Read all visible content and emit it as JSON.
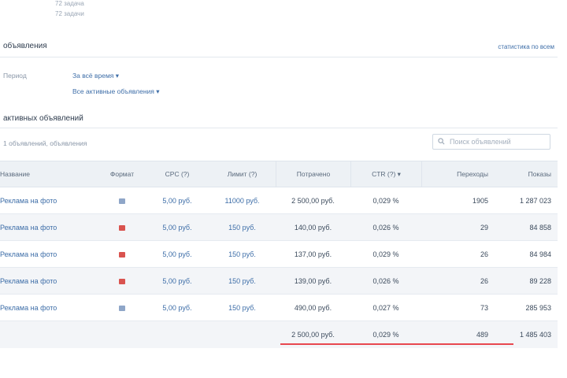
{
  "top_rows": [
    {
      "value": "72 задача"
    },
    {
      "value": "72 задачи"
    }
  ],
  "section1": {
    "title": "объявления",
    "right_link": "статистика по всем"
  },
  "filters": {
    "label": "Период",
    "time_select": "За всё время ▾",
    "ads_select": "Все активные объявления ▾"
  },
  "section2": {
    "title": "активных объявлений",
    "subtitle": "1 объявлений, объявления"
  },
  "search": {
    "placeholder": "Поиск объявлений"
  },
  "table": {
    "headers": {
      "name": "Название",
      "format": "Формат",
      "cpc": "CPC (?)",
      "limit": "Лимит (?)",
      "spent": "Потрачено",
      "ctr": "CTR (?) ▾",
      "clicks": "Переходы",
      "impressions": "Показы"
    },
    "rows": [
      {
        "name": "Реклама на фото",
        "format_color": "#8fa6c8",
        "cpc": "5,00 руб.",
        "limit": "11000 руб.",
        "spent": "2 500,00 руб.",
        "ctr": "0,029 %",
        "clicks": "1905",
        "impressions": "1 287 023"
      },
      {
        "name": "Реклама на фото",
        "format_color": "#d9534f",
        "cpc": "5,00 руб.",
        "limit": "150 руб.",
        "spent": "140,00 руб.",
        "ctr": "0,026 %",
        "clicks": "29",
        "impressions": "84 858"
      },
      {
        "name": "Реклама на фото",
        "format_color": "#d9534f",
        "cpc": "5,00 руб.",
        "limit": "150 руб.",
        "spent": "137,00 руб.",
        "ctr": "0,029 %",
        "clicks": "26",
        "impressions": "84 984"
      },
      {
        "name": "Реклама на фото",
        "format_color": "#d9534f",
        "cpc": "5,00 руб.",
        "limit": "150 руб.",
        "spent": "139,00 руб.",
        "ctr": "0,026 %",
        "clicks": "26",
        "impressions": "89 228"
      },
      {
        "name": "Реклама на фото",
        "format_color": "#8fa6c8",
        "cpc": "5,00 руб.",
        "limit": "150 руб.",
        "spent": "490,00 руб.",
        "ctr": "0,027 %",
        "clicks": "73",
        "impressions": "285 953"
      }
    ],
    "total": {
      "spent": "2 500,00 руб.",
      "ctr": "0,029 %",
      "clicks": "489",
      "impressions": "1 485 403"
    }
  },
  "colors": {
    "accent": "#3e6ea8",
    "highlight_underline": "#e8474f",
    "header_bg": "#edf1f5"
  }
}
